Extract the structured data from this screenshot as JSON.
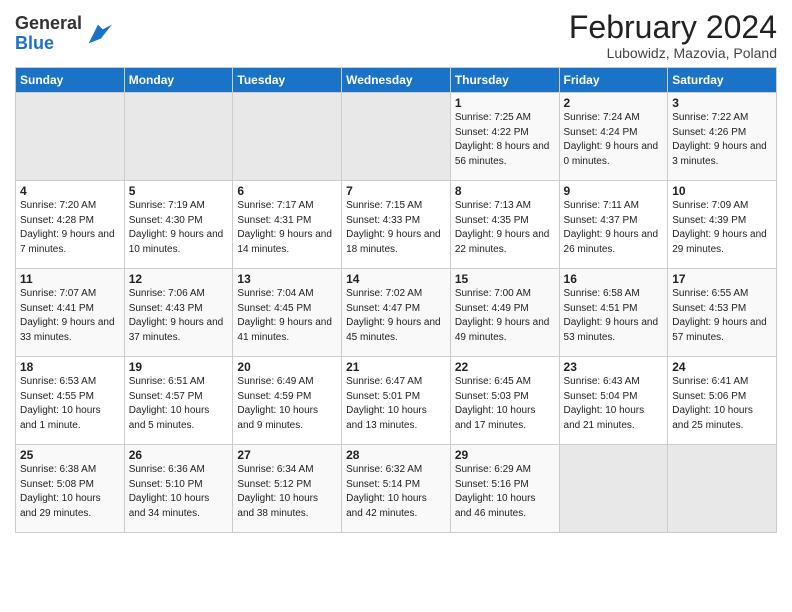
{
  "header": {
    "logo_general": "General",
    "logo_blue": "Blue",
    "title": "February 2024",
    "subtitle": "Lubowidz, Mazovia, Poland"
  },
  "days_of_week": [
    "Sunday",
    "Monday",
    "Tuesday",
    "Wednesday",
    "Thursday",
    "Friday",
    "Saturday"
  ],
  "weeks": [
    [
      {
        "day": "",
        "info": ""
      },
      {
        "day": "",
        "info": ""
      },
      {
        "day": "",
        "info": ""
      },
      {
        "day": "",
        "info": ""
      },
      {
        "day": "1",
        "info": "Sunrise: 7:25 AM\nSunset: 4:22 PM\nDaylight: 8 hours\nand 56 minutes."
      },
      {
        "day": "2",
        "info": "Sunrise: 7:24 AM\nSunset: 4:24 PM\nDaylight: 9 hours\nand 0 minutes."
      },
      {
        "day": "3",
        "info": "Sunrise: 7:22 AM\nSunset: 4:26 PM\nDaylight: 9 hours\nand 3 minutes."
      }
    ],
    [
      {
        "day": "4",
        "info": "Sunrise: 7:20 AM\nSunset: 4:28 PM\nDaylight: 9 hours\nand 7 minutes."
      },
      {
        "day": "5",
        "info": "Sunrise: 7:19 AM\nSunset: 4:30 PM\nDaylight: 9 hours\nand 10 minutes."
      },
      {
        "day": "6",
        "info": "Sunrise: 7:17 AM\nSunset: 4:31 PM\nDaylight: 9 hours\nand 14 minutes."
      },
      {
        "day": "7",
        "info": "Sunrise: 7:15 AM\nSunset: 4:33 PM\nDaylight: 9 hours\nand 18 minutes."
      },
      {
        "day": "8",
        "info": "Sunrise: 7:13 AM\nSunset: 4:35 PM\nDaylight: 9 hours\nand 22 minutes."
      },
      {
        "day": "9",
        "info": "Sunrise: 7:11 AM\nSunset: 4:37 PM\nDaylight: 9 hours\nand 26 minutes."
      },
      {
        "day": "10",
        "info": "Sunrise: 7:09 AM\nSunset: 4:39 PM\nDaylight: 9 hours\nand 29 minutes."
      }
    ],
    [
      {
        "day": "11",
        "info": "Sunrise: 7:07 AM\nSunset: 4:41 PM\nDaylight: 9 hours\nand 33 minutes."
      },
      {
        "day": "12",
        "info": "Sunrise: 7:06 AM\nSunset: 4:43 PM\nDaylight: 9 hours\nand 37 minutes."
      },
      {
        "day": "13",
        "info": "Sunrise: 7:04 AM\nSunset: 4:45 PM\nDaylight: 9 hours\nand 41 minutes."
      },
      {
        "day": "14",
        "info": "Sunrise: 7:02 AM\nSunset: 4:47 PM\nDaylight: 9 hours\nand 45 minutes."
      },
      {
        "day": "15",
        "info": "Sunrise: 7:00 AM\nSunset: 4:49 PM\nDaylight: 9 hours\nand 49 minutes."
      },
      {
        "day": "16",
        "info": "Sunrise: 6:58 AM\nSunset: 4:51 PM\nDaylight: 9 hours\nand 53 minutes."
      },
      {
        "day": "17",
        "info": "Sunrise: 6:55 AM\nSunset: 4:53 PM\nDaylight: 9 hours\nand 57 minutes."
      }
    ],
    [
      {
        "day": "18",
        "info": "Sunrise: 6:53 AM\nSunset: 4:55 PM\nDaylight: 10 hours\nand 1 minute."
      },
      {
        "day": "19",
        "info": "Sunrise: 6:51 AM\nSunset: 4:57 PM\nDaylight: 10 hours\nand 5 minutes."
      },
      {
        "day": "20",
        "info": "Sunrise: 6:49 AM\nSunset: 4:59 PM\nDaylight: 10 hours\nand 9 minutes."
      },
      {
        "day": "21",
        "info": "Sunrise: 6:47 AM\nSunset: 5:01 PM\nDaylight: 10 hours\nand 13 minutes."
      },
      {
        "day": "22",
        "info": "Sunrise: 6:45 AM\nSunset: 5:03 PM\nDaylight: 10 hours\nand 17 minutes."
      },
      {
        "day": "23",
        "info": "Sunrise: 6:43 AM\nSunset: 5:04 PM\nDaylight: 10 hours\nand 21 minutes."
      },
      {
        "day": "24",
        "info": "Sunrise: 6:41 AM\nSunset: 5:06 PM\nDaylight: 10 hours\nand 25 minutes."
      }
    ],
    [
      {
        "day": "25",
        "info": "Sunrise: 6:38 AM\nSunset: 5:08 PM\nDaylight: 10 hours\nand 29 minutes."
      },
      {
        "day": "26",
        "info": "Sunrise: 6:36 AM\nSunset: 5:10 PM\nDaylight: 10 hours\nand 34 minutes."
      },
      {
        "day": "27",
        "info": "Sunrise: 6:34 AM\nSunset: 5:12 PM\nDaylight: 10 hours\nand 38 minutes."
      },
      {
        "day": "28",
        "info": "Sunrise: 6:32 AM\nSunset: 5:14 PM\nDaylight: 10 hours\nand 42 minutes."
      },
      {
        "day": "29",
        "info": "Sunrise: 6:29 AM\nSunset: 5:16 PM\nDaylight: 10 hours\nand 46 minutes."
      },
      {
        "day": "",
        "info": ""
      },
      {
        "day": "",
        "info": ""
      }
    ]
  ]
}
